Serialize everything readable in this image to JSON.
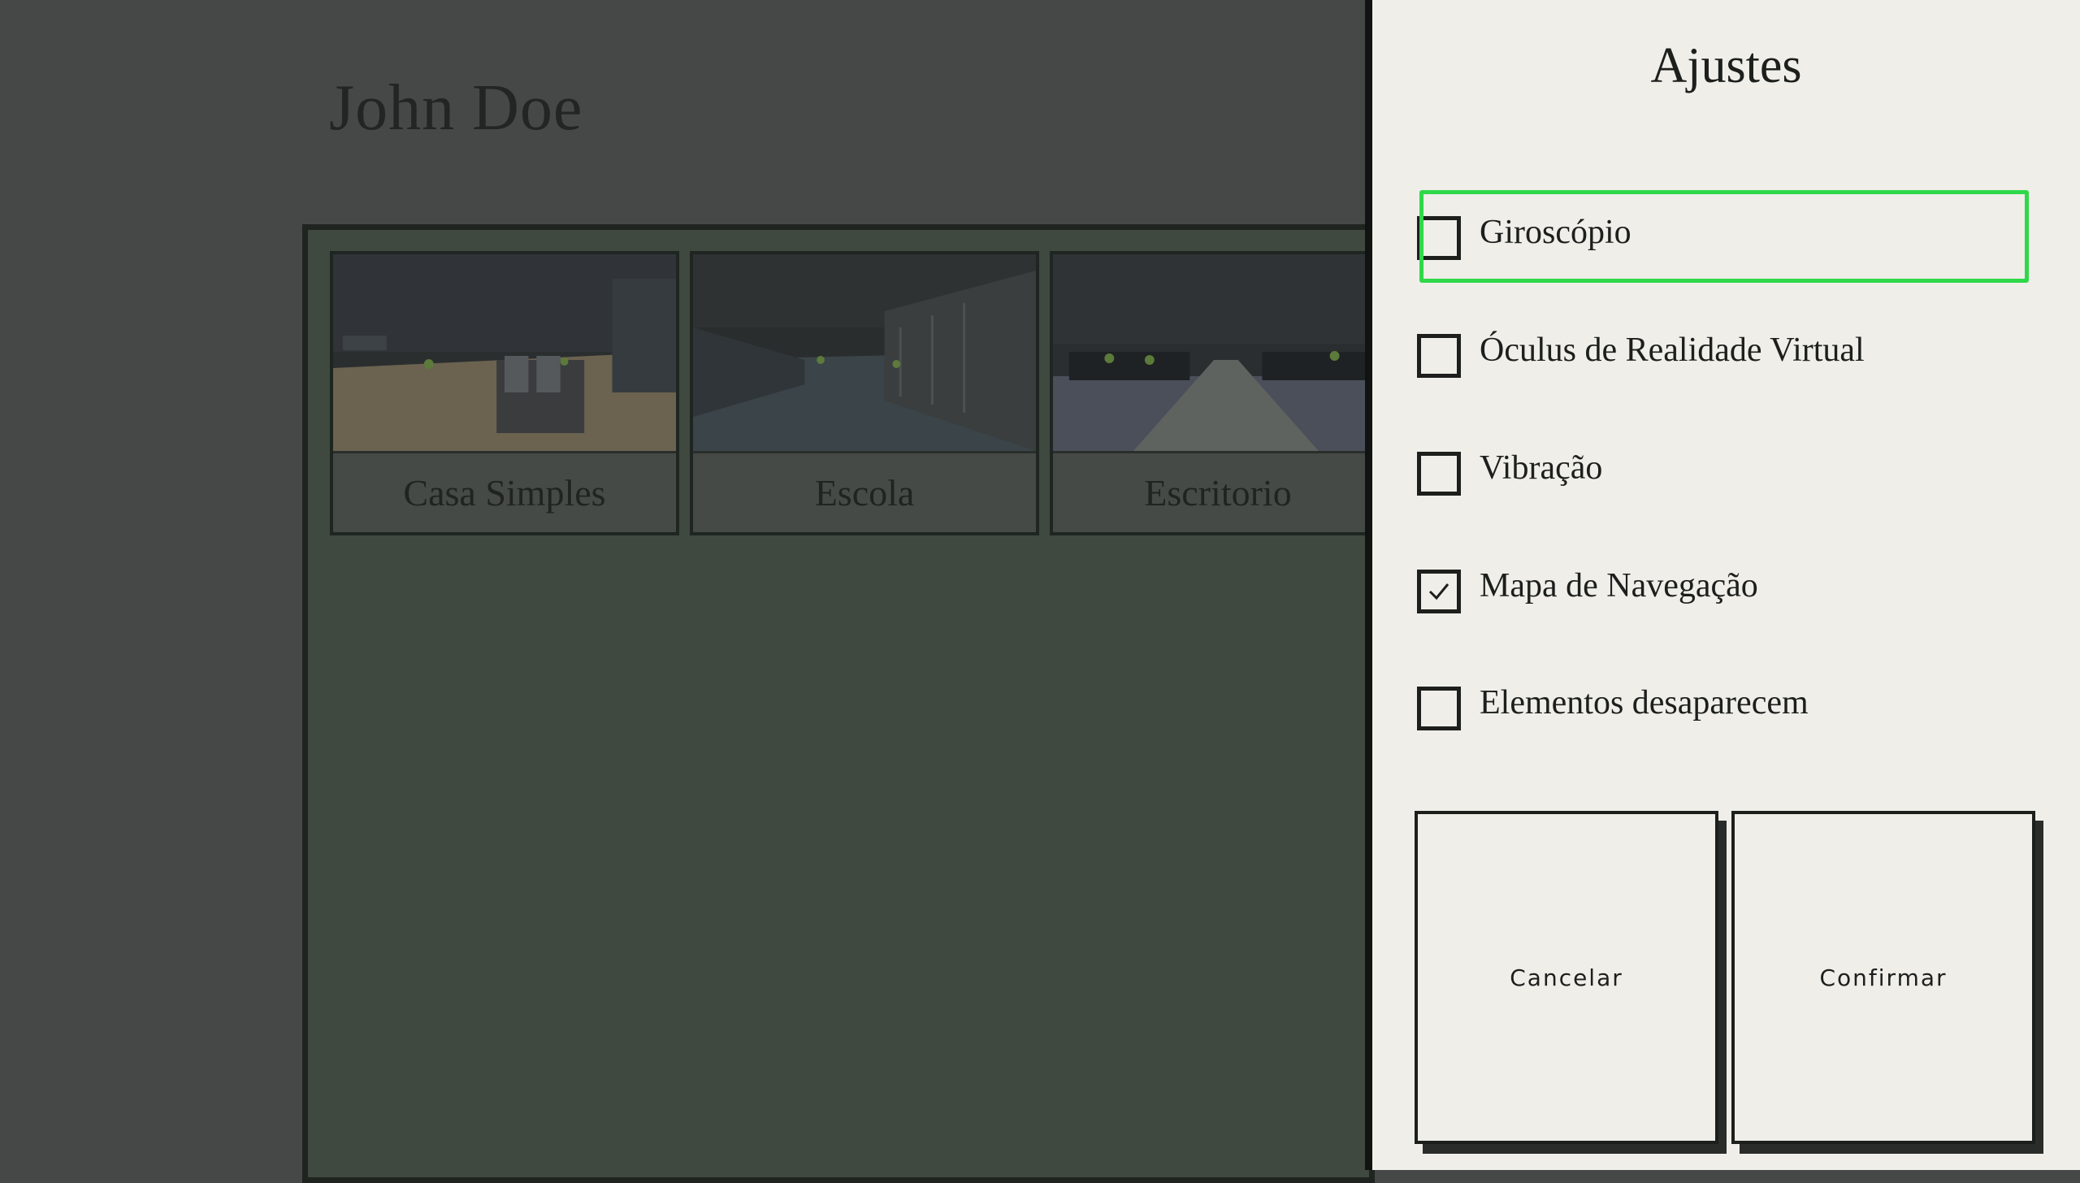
{
  "profile": {
    "name": "John Doe"
  },
  "scenes": [
    {
      "label": "Casa Simples"
    },
    {
      "label": "Escola"
    },
    {
      "label": "Escritorio"
    }
  ],
  "settings": {
    "title": "Ajustes",
    "options": [
      {
        "label": "Giroscópio",
        "checked": false,
        "focused": true
      },
      {
        "label": "Óculus de Realidade Virtual",
        "checked": false,
        "focused": false
      },
      {
        "label": "Vibração",
        "checked": false,
        "focused": false
      },
      {
        "label": "Mapa de Navegação",
        "checked": true,
        "focused": false
      },
      {
        "label": "Elementos desaparecem",
        "checked": false,
        "focused": false
      }
    ],
    "cancel_label": "Cancelar",
    "confirm_label": "Confirmar"
  },
  "colors": {
    "focus_outline": "#2fd84a",
    "drawer_bg": "#efeee8",
    "overlay_dim": "#464847",
    "scene_panel": "#3f493f"
  }
}
